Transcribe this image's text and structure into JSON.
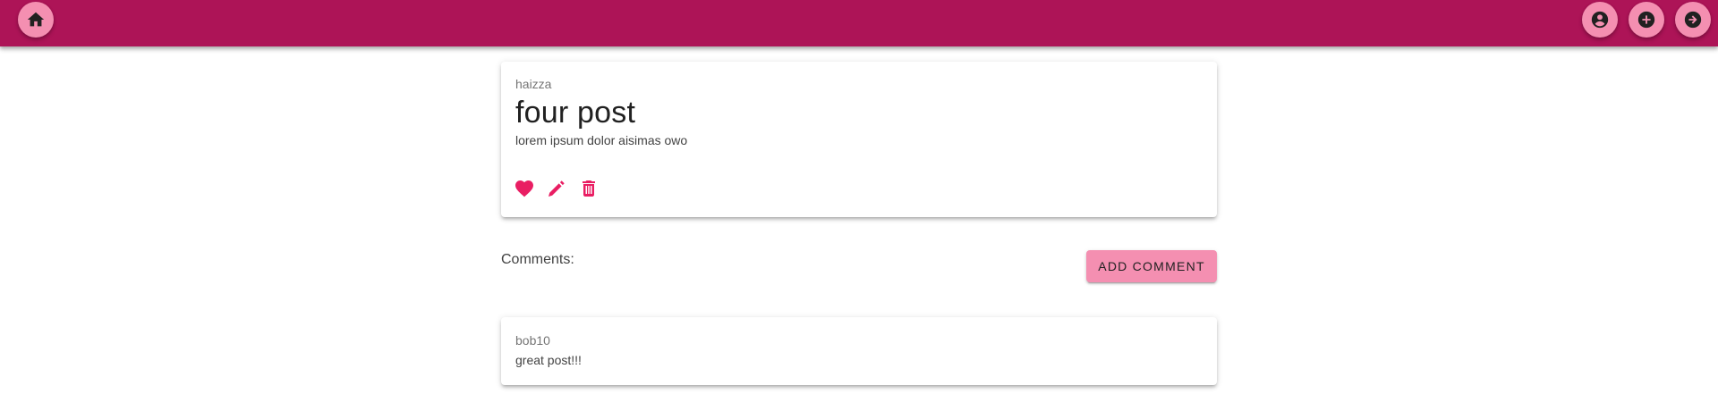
{
  "header": {
    "background_color": "#ad1457",
    "button_color": "#f48fb1",
    "home_icon": "home-icon",
    "right_icons": [
      "account-circle-icon",
      "add-circle-icon",
      "arrow-right-circle-icon"
    ]
  },
  "post": {
    "author": "haizza",
    "title": "four post",
    "body": "lorem ipsum dolor aisimas owo",
    "action_icons": [
      "heart-icon",
      "pencil-icon",
      "trash-icon"
    ],
    "accent_color": "#e91e63"
  },
  "comments": {
    "label": "Comments:",
    "add_button_label": "ADD COMMENT",
    "items": [
      {
        "author": "bob10",
        "text": "great post!!!"
      }
    ]
  }
}
